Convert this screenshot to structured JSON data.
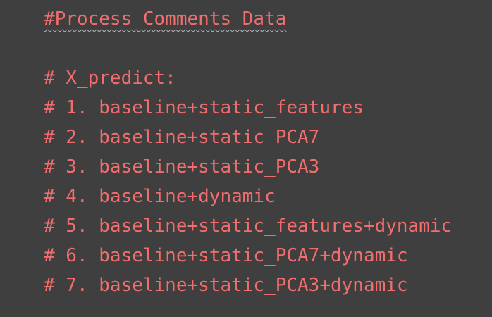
{
  "editor": {
    "background": "#3f3f3f",
    "comment_color": "#f26d6d",
    "lines": [
      "#Process Comments Data",
      "",
      "# X_predict:",
      "# 1. baseline+static_features",
      "# 2. baseline+static_PCA7",
      "# 3. baseline+static_PCA3",
      "# 4. baseline+dynamic",
      "# 5. baseline+static_features+dynamic",
      "# 6. baseline+static_PCA7+dynamic",
      "# 7. baseline+static_PCA3+dynamic"
    ]
  }
}
